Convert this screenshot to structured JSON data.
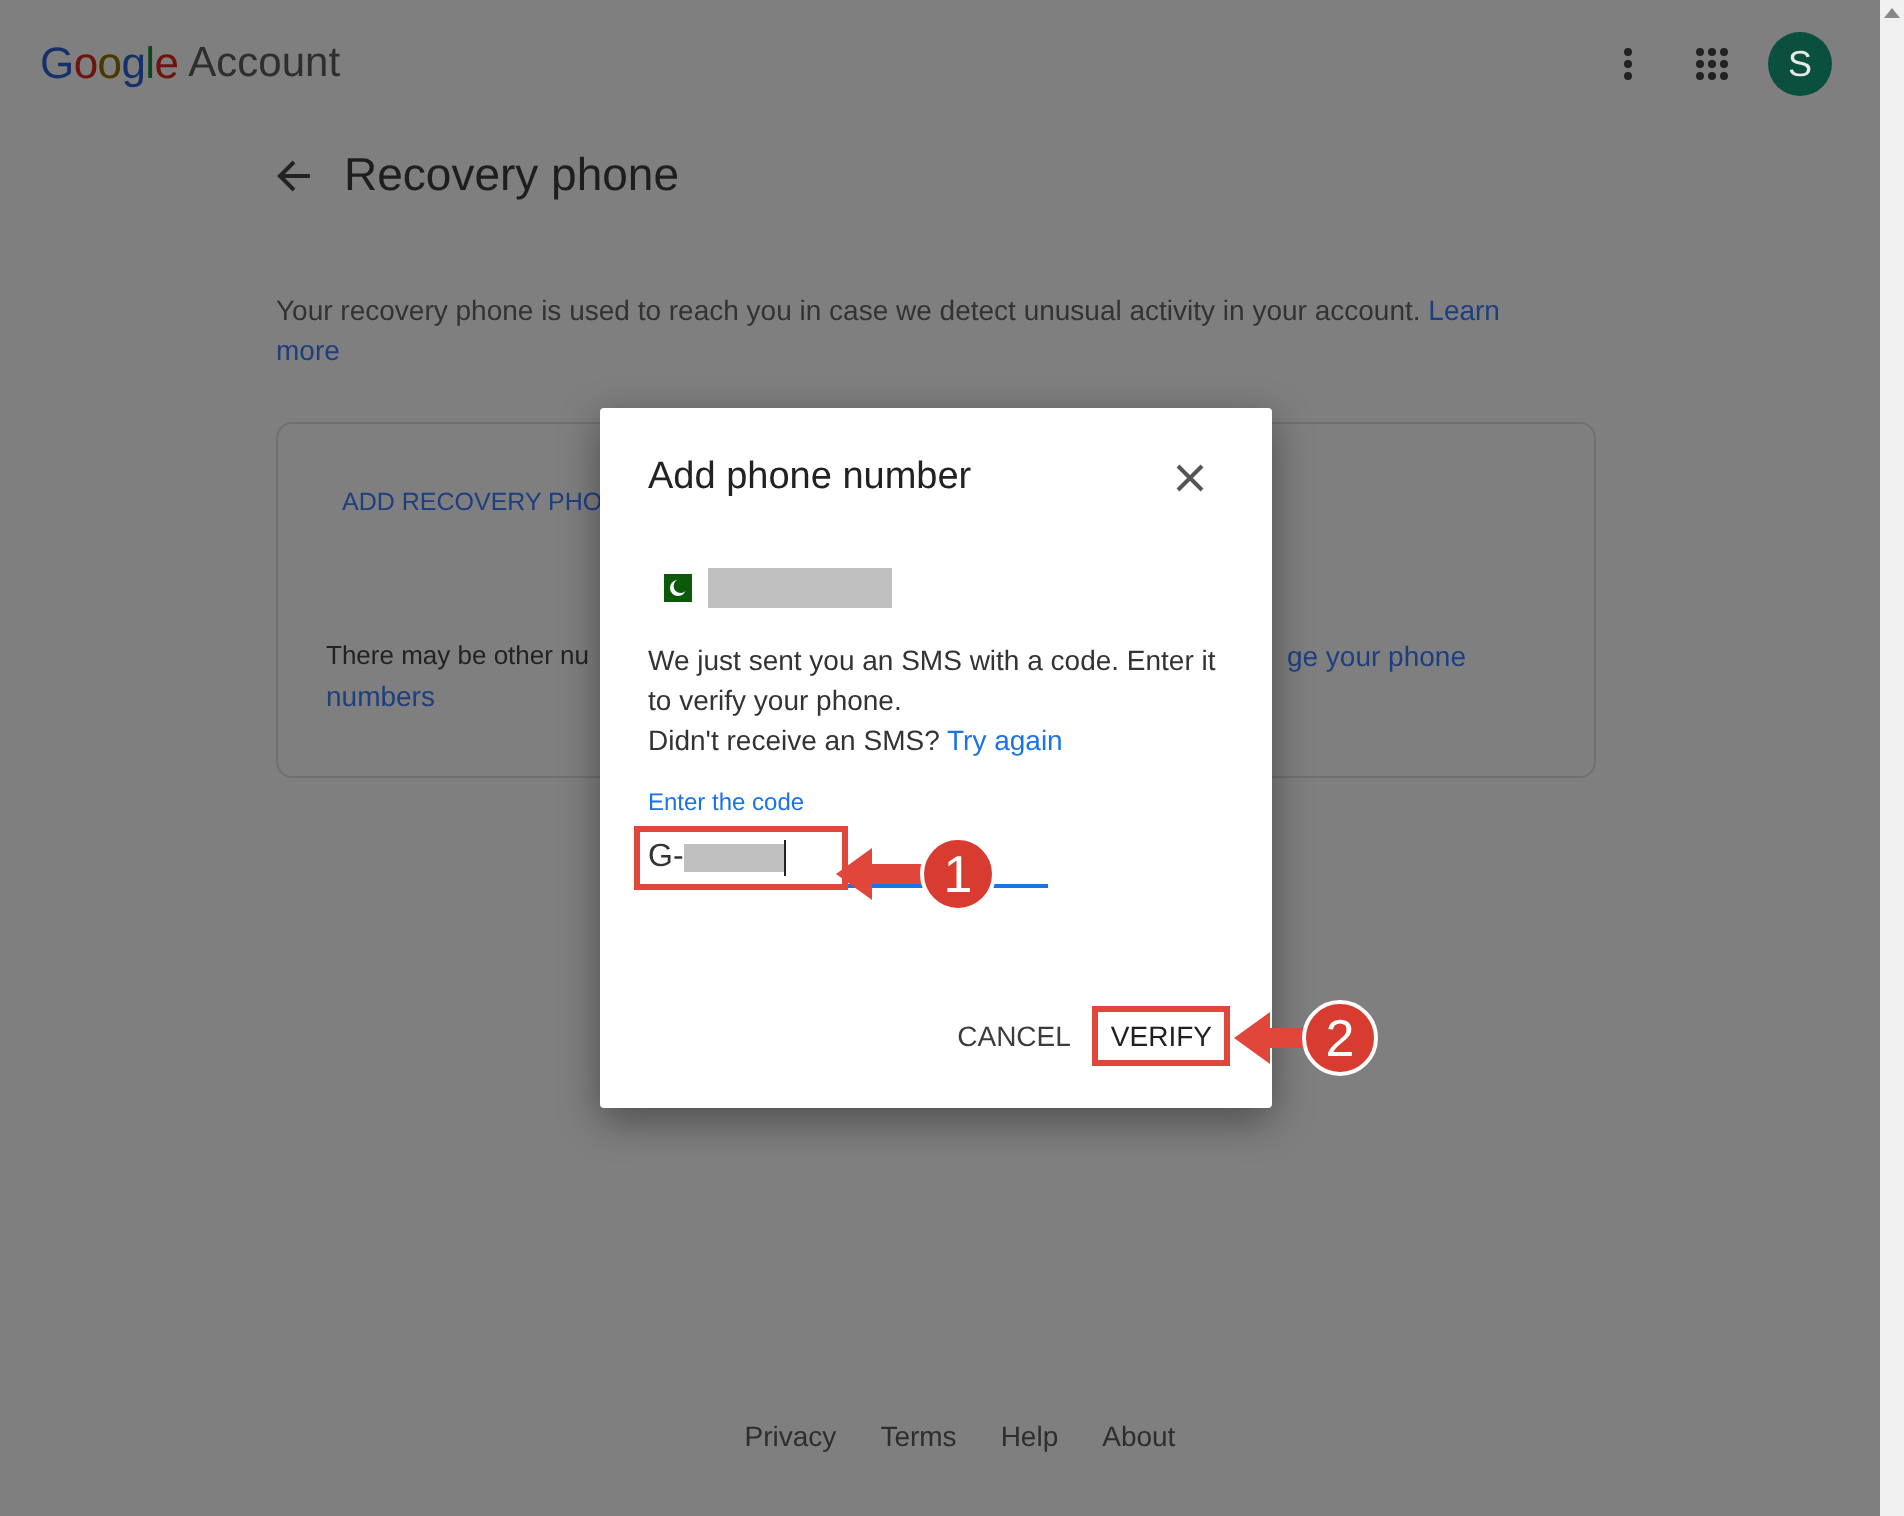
{
  "header": {
    "logo": "Google",
    "product": "Account",
    "avatar": "S"
  },
  "page": {
    "title": "Recovery phone",
    "description": "Your recovery phone is used to reach you in case we detect unusual activity in your account.",
    "learn_more_start": "Learn",
    "learn_more_end": "more"
  },
  "card": {
    "add_action": "ADD RECOVERY PHO",
    "note_start": "There may be other nu",
    "note_link_end": "ge your phone",
    "note_link_cont": "numbers"
  },
  "dialog": {
    "title": "Add phone number",
    "message": "We just sent you an SMS with a code. Enter it to verify your phone.",
    "retry_prompt": "Didn't receive an SMS?",
    "retry_link": "Try again",
    "field_label": "Enter the code",
    "field_value": "G-",
    "buttons": [
      {
        "label": "CANCEL",
        "kind": "text"
      },
      {
        "label": "VERIFY",
        "kind": "primary"
      }
    ]
  },
  "callouts": [
    {
      "number": "1"
    },
    {
      "number": "2"
    }
  ],
  "footer": [
    "Privacy",
    "Terms",
    "Help",
    "About"
  ]
}
